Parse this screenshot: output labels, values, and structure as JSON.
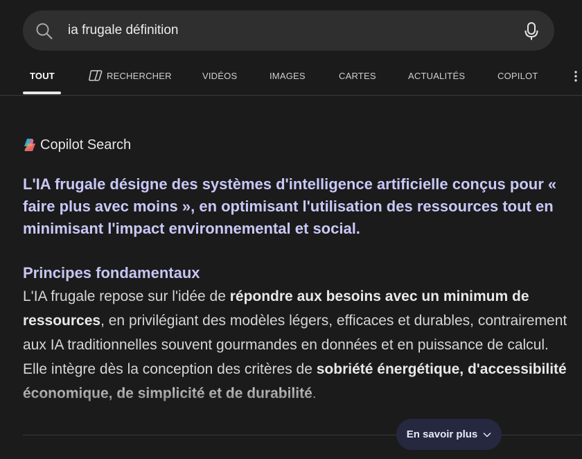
{
  "search": {
    "query": "ia frugale définition"
  },
  "tabs": [
    {
      "label": "TOUT"
    },
    {
      "label": "RECHERCHER"
    },
    {
      "label": "VIDÉOS"
    },
    {
      "label": "IMAGES"
    },
    {
      "label": "CARTES"
    },
    {
      "label": "ACTUALITÉS"
    },
    {
      "label": "COPILOT"
    }
  ],
  "copilot": {
    "title": "Copilot Search",
    "summary": "L'IA frugale désigne des systèmes d'intelligence artificielle conçus pour « faire plus avec moins », en optimisant l'utilisation des ressources tout en minimisant l'impact environnemental et social.",
    "section_heading": "Principes fondamentaux",
    "body": {
      "p1": "L'IA frugale repose sur l'idée de ",
      "b1": "répondre aux besoins avec un minimum de ressources",
      "p2": ", en privilégiant des modèles légers, efficaces et durables, contrairement aux IA traditionnelles souvent gourmandes en données et en puissance de calcul. Elle intègre dès la conception des critères de ",
      "b2": "sobriété énergétique, d'accessibilité économique, de simplicité et de durabilité",
      "p3": "."
    },
    "more_label": "En savoir plus"
  },
  "colors": {
    "background": "#1b1b1b",
    "search_bg": "#2f2f2f",
    "accent_text": "#c8c8f8",
    "button_bg": "#262840"
  }
}
